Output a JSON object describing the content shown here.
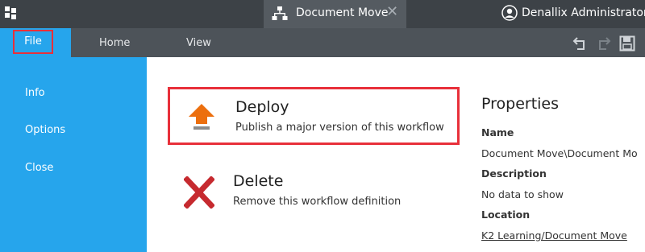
{
  "window": {
    "tab_title": "Document Move",
    "tab_icon": "workflow-hierarchy-icon",
    "close_icon": "close-icon",
    "user_name": "Denallix Administrator",
    "user_icon": "user-avatar-icon"
  },
  "menubar": {
    "file_label": "File",
    "home_label": "Home",
    "view_label": "View",
    "toolbar_icons": [
      "undo-icon",
      "redo-icon",
      "save-icon"
    ]
  },
  "sidebar": {
    "items": [
      {
        "label": "Info"
      },
      {
        "label": "Options"
      },
      {
        "label": "Close"
      }
    ]
  },
  "actions": {
    "deploy": {
      "title": "Deploy",
      "description": "Publish a major version of this workflow",
      "icon": "deploy-upload-icon"
    },
    "delete": {
      "title": "Delete",
      "description": "Remove this workflow definition",
      "icon": "delete-x-icon"
    }
  },
  "properties": {
    "heading": "Properties",
    "name_label": "Name",
    "name_value": "Document Move\\Document Mo",
    "description_label": "Description",
    "description_value": "No data to show",
    "location_label": "Location",
    "location_value": "K2 Learning/Document Move"
  },
  "colors": {
    "accent": "#26a5ec",
    "titlebar": "#3d4247",
    "menubar": "#4d5359",
    "highlight": "#e8303a",
    "deploy_orange": "#ec6f0e",
    "delete_red": "#c62a2f"
  }
}
